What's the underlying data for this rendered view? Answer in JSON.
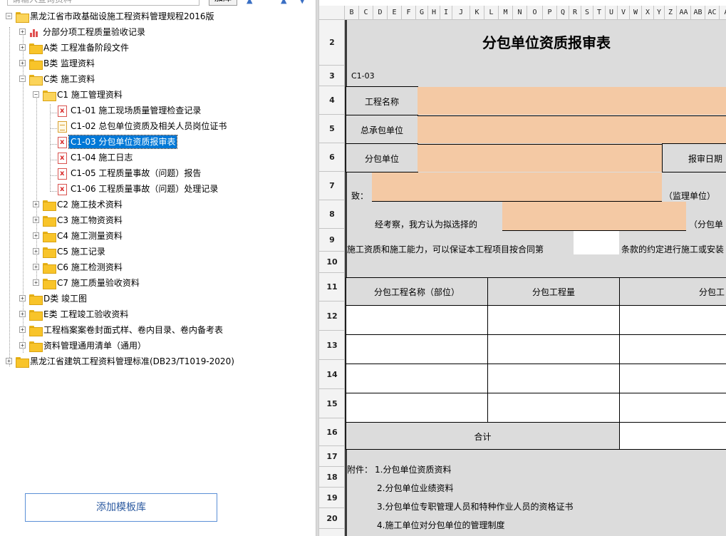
{
  "toolbar": {
    "search_placeholder": "请输入查询资料",
    "add_button": "加库"
  },
  "tree": {
    "root1": "黑龙江省市政基础设施工程资料管理规程2016版",
    "records": "分部分项工程质量验收记录",
    "a": "A类 工程准备阶段文件",
    "b": "B类 监理资料",
    "c": "C类 施工资料",
    "c1": "C1 施工管理资料",
    "c1_01": "C1-01 施工现场质量管理检查记录",
    "c1_02": "C1-02 总包单位资质及相关人员岗位证书",
    "c1_03": "C1-03 分包单位资质报审表",
    "c1_04": "C1-04 施工日志",
    "c1_05": "C1-05 工程质量事故（问题）报告",
    "c1_06": "C1-06 工程质量事故（问题）处理记录",
    "c2": "C2 施工技术资料",
    "c3": "C3 施工物资资料",
    "c4": "C4 施工测量资料",
    "c5": "C5 施工记录",
    "c6": "C6 施工检测资料",
    "c7": "C7 施工质量验收资料",
    "d": "D类 竣工图",
    "e": "E类 工程竣工验收资料",
    "archive": "工程档案案卷封面式样、卷内目录、卷内备考表",
    "general": "资料管理通用清单（通用）",
    "root2": "黑龙江省建筑工程资料管理标准(DB23/T1019-2020)"
  },
  "add_library_button": "添加模板库",
  "sheet": {
    "columns": [
      "B",
      "C",
      "D",
      "E",
      "F",
      "G",
      "H",
      "I",
      "J",
      "K",
      "L",
      "M",
      "N",
      "O",
      "P",
      "Q",
      "R",
      "S",
      "T",
      "U",
      "V",
      "W",
      "X",
      "Y",
      "Z",
      "AA",
      "AB",
      "AC",
      "A"
    ],
    "rows": [
      "2",
      "3",
      "4",
      "5",
      "6",
      "7",
      "8",
      "9",
      "10",
      "11",
      "12",
      "13",
      "14",
      "15",
      "16",
      "17",
      "18",
      "19",
      "20"
    ],
    "title": "分包单位资质报审表",
    "code": "C1-03",
    "project_name_label": "工程名称",
    "general_contractor_label": "总承包单位",
    "subcontractor_label": "分包单位",
    "review_date_label": "报审日期",
    "to_label": "致：",
    "supervisor_label": "（监理单位）",
    "inspected_text": "经考察，我方认为拟选择的",
    "sub_unit_suffix": "（分包单",
    "qualification_text": "施工资质和施工能力，可以保证本工程项目按合同第",
    "clause_text": "条款的约定进行施工或安装",
    "table_header": {
      "name": "分包工程名称（部位）",
      "quantity": "分包工程量",
      "third": "分包工"
    },
    "total_label": "合计",
    "attachments_label": "附件：",
    "attachments": [
      "1.分包单位资质资料",
      "2.分包单位业绩资料",
      "3.分包单位专职管理人员和特种作业人员的资格证书",
      "4.施工单位对分包单位的管理制度"
    ]
  },
  "colors": {
    "fill_peach": "#f4c9a4",
    "selection": "#0078d7",
    "sheet_background": "#dcdcdc"
  }
}
